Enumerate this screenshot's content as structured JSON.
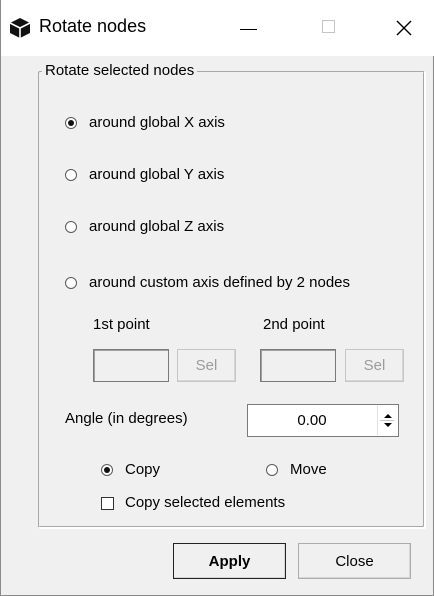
{
  "window": {
    "title": "Rotate nodes",
    "icon": "cube-icon"
  },
  "group": {
    "title": "Rotate selected nodes"
  },
  "axis_options": [
    {
      "label": "around global X axis",
      "selected": true
    },
    {
      "label": "around global Y axis",
      "selected": false
    },
    {
      "label": "around global Z axis",
      "selected": false
    },
    {
      "label": "around custom axis defined by 2 nodes",
      "selected": false
    }
  ],
  "custom_axis": {
    "point1_label": "1st point",
    "point2_label": "2nd point",
    "point1_value": "",
    "point2_value": "",
    "sel_label": "Sel"
  },
  "angle": {
    "label": "Angle (in degrees)",
    "value": "0.00"
  },
  "mode": {
    "copy_label": "Copy",
    "move_label": "Move",
    "selected": "Copy"
  },
  "copy_elements": {
    "label": "Copy selected elements",
    "checked": false
  },
  "buttons": {
    "apply": "Apply",
    "close": "Close"
  }
}
